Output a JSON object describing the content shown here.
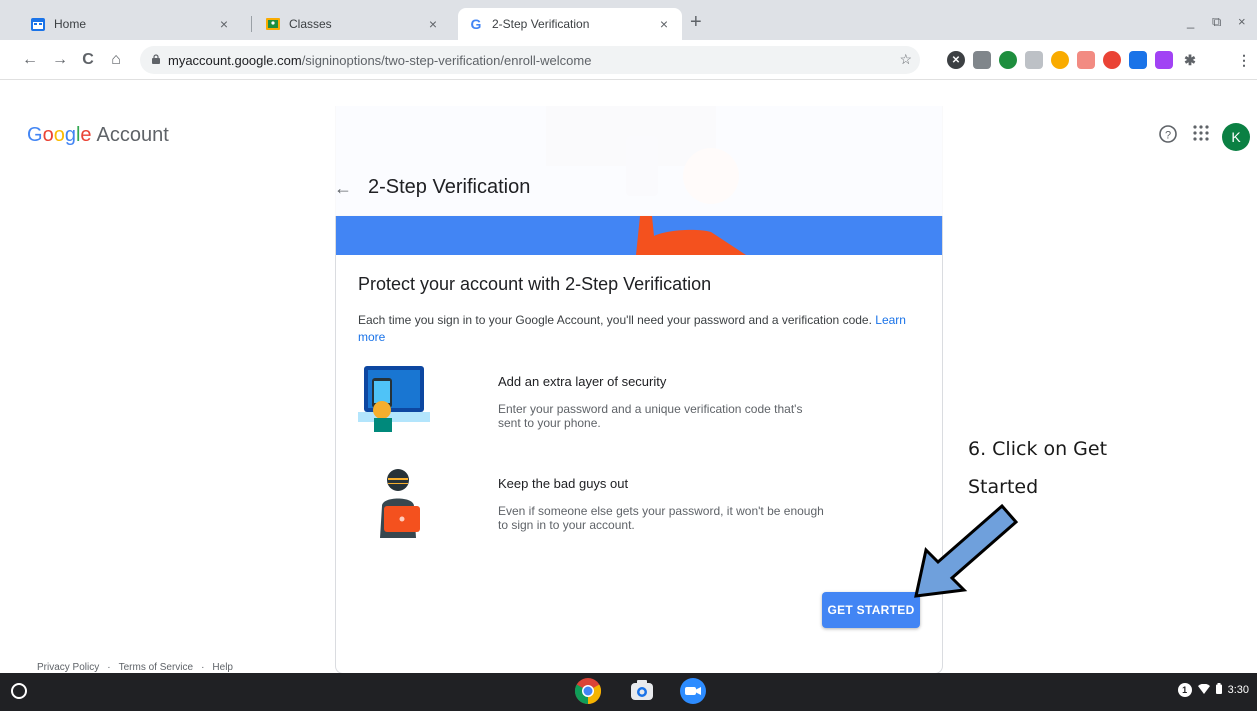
{
  "browser": {
    "tabs": [
      {
        "title": "Home",
        "close": "×"
      },
      {
        "title": "Classes",
        "close": "×"
      },
      {
        "title": "2-Step Verification",
        "close": "×"
      }
    ],
    "new_tab": "+",
    "window_controls": {
      "minimize": "_",
      "restore": "⧉",
      "close": "×"
    },
    "nav": {
      "back": "←",
      "forward": "→",
      "reload": "C",
      "home": "⌂"
    },
    "url": {
      "host": "myaccount.google.com",
      "path": "/signinoptions/two-step-verification/enroll-welcome"
    },
    "star": "☆"
  },
  "header": {
    "logo": {
      "g1": "G",
      "g2": "o",
      "g3": "o",
      "g4": "g",
      "g5": "l",
      "g6": "e",
      "account": "Account"
    },
    "help_icon": "?",
    "apps_icon": "⋮⋮⋮",
    "avatar_letter": "K",
    "back_arrow": "←",
    "page_title": "2-Step Verification"
  },
  "card": {
    "title": "Protect your account with 2-Step Verification",
    "description": "Each time you sign in to your Google Account, you'll need your password and a verification code.",
    "learn_more": "Learn more",
    "features": [
      {
        "heading": "Add an extra layer of security",
        "text": "Enter your password and a unique verification code that's sent to your phone."
      },
      {
        "heading": "Keep the bad guys out",
        "text": "Even if someone else gets your password, it won't be enough to sign in to your account."
      }
    ],
    "button": "GET STARTED"
  },
  "annotation": {
    "line1": "6. Click on Get",
    "line2": "Started",
    "arrow_color": "#6fa0dc"
  },
  "footer": {
    "privacy": "Privacy Policy",
    "terms": "Terms of Service",
    "help": "Help",
    "separator": "·"
  },
  "shelf": {
    "notification_count": "1",
    "time": "3:30"
  },
  "colors": {
    "primary_blue": "#4285f4",
    "avatar_green": "#0b8043",
    "illustration_orange": "#f4511e"
  }
}
